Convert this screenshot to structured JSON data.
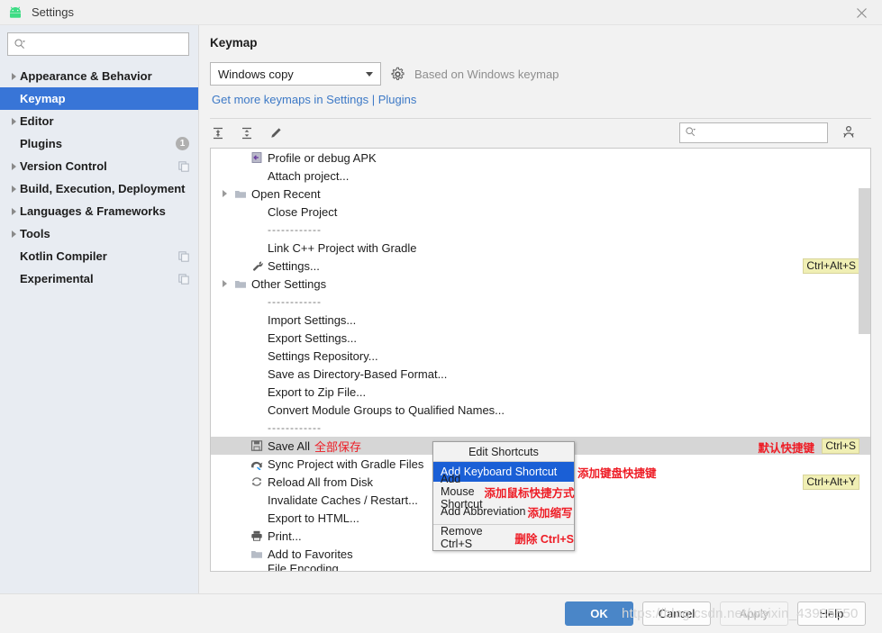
{
  "window": {
    "title": "Settings",
    "app_icon": "android-icon",
    "close_icon": "close-icon"
  },
  "sidebar": {
    "search": {
      "placeholder": "",
      "value": "",
      "icon": "search-icon"
    },
    "items": [
      {
        "label": "Appearance & Behavior",
        "expandable": true,
        "selected": false,
        "badge": null,
        "trailing_icon": null
      },
      {
        "label": "Keymap",
        "expandable": false,
        "selected": true,
        "badge": null,
        "trailing_icon": null
      },
      {
        "label": "Editor",
        "expandable": true,
        "selected": false,
        "badge": null,
        "trailing_icon": null
      },
      {
        "label": "Plugins",
        "expandable": false,
        "selected": false,
        "badge": "1",
        "trailing_icon": null
      },
      {
        "label": "Version Control",
        "expandable": true,
        "selected": false,
        "badge": null,
        "trailing_icon": "copy-icon"
      },
      {
        "label": "Build, Execution, Deployment",
        "expandable": true,
        "selected": false,
        "badge": null,
        "trailing_icon": null
      },
      {
        "label": "Languages & Frameworks",
        "expandable": true,
        "selected": false,
        "badge": null,
        "trailing_icon": null
      },
      {
        "label": "Tools",
        "expandable": true,
        "selected": false,
        "badge": null,
        "trailing_icon": null
      },
      {
        "label": "Kotlin Compiler",
        "expandable": false,
        "selected": false,
        "badge": null,
        "trailing_icon": "copy-icon"
      },
      {
        "label": "Experimental",
        "expandable": false,
        "selected": false,
        "badge": null,
        "trailing_icon": "copy-icon"
      }
    ]
  },
  "main": {
    "title": "Keymap",
    "keymap_select": {
      "value": "Windows copy",
      "caret_icon": "chevron-down-icon"
    },
    "gear_icon": "gear-icon",
    "based_on": "Based on Windows keymap",
    "plugins_link": "Get more keymaps in Settings | Plugins",
    "toolbar": {
      "expand_all_icon": "expand-all-icon",
      "collapse_all_icon": "collapse-all-icon",
      "edit_icon": "pencil-icon"
    },
    "tree_search": {
      "placeholder": "",
      "value": "",
      "icon": "search-icon"
    },
    "filter_icon": "find-actions-icon"
  },
  "tree": {
    "rows": [
      {
        "indent": 2,
        "icon": "profile-apk-icon",
        "label": "Profile or debug APK",
        "arrow": false
      },
      {
        "indent": 2,
        "icon": null,
        "label": "Attach project...",
        "arrow": false
      },
      {
        "indent": 1,
        "icon": "folder-icon",
        "label": "Open Recent",
        "arrow": true
      },
      {
        "indent": 2,
        "icon": null,
        "label": "Close Project",
        "arrow": false
      },
      {
        "indent": 2,
        "icon": null,
        "label": "------------",
        "arrow": false,
        "separator": true
      },
      {
        "indent": 2,
        "icon": null,
        "label": "Link C++ Project with Gradle",
        "arrow": false
      },
      {
        "indent": 2,
        "icon": "wrench-icon",
        "label": "Settings...",
        "arrow": false,
        "shortcut": "Ctrl+Alt+S"
      },
      {
        "indent": 1,
        "icon": "folder-icon",
        "label": "Other Settings",
        "arrow": true
      },
      {
        "indent": 2,
        "icon": null,
        "label": "------------",
        "arrow": false,
        "separator": true
      },
      {
        "indent": 2,
        "icon": null,
        "label": "Import Settings...",
        "arrow": false
      },
      {
        "indent": 2,
        "icon": null,
        "label": "Export Settings...",
        "arrow": false
      },
      {
        "indent": 2,
        "icon": null,
        "label": "Settings Repository...",
        "arrow": false
      },
      {
        "indent": 2,
        "icon": null,
        "label": "Save as Directory-Based Format...",
        "arrow": false
      },
      {
        "indent": 2,
        "icon": null,
        "label": "Export to Zip File...",
        "arrow": false
      },
      {
        "indent": 2,
        "icon": null,
        "label": "Convert Module Groups to Qualified Names...",
        "arrow": false
      },
      {
        "indent": 2,
        "icon": null,
        "label": "------------",
        "arrow": false,
        "separator": true
      },
      {
        "indent": 2,
        "icon": "save-icon",
        "label": "Save All",
        "annotation": "全部保存",
        "arrow": false,
        "selected": true,
        "shortcut": "Ctrl+S",
        "shortcut_note": "默认快捷键"
      },
      {
        "indent": 2,
        "icon": "gradle-icon",
        "label": "Sync Project with Gradle Files",
        "arrow": false
      },
      {
        "indent": 2,
        "icon": "reload-icon",
        "label": "Reload All from Disk",
        "arrow": false,
        "shortcut": "Ctrl+Alt+Y"
      },
      {
        "indent": 2,
        "icon": null,
        "label": "Invalidate Caches / Restart...",
        "arrow": false
      },
      {
        "indent": 2,
        "icon": null,
        "label": "Export to HTML...",
        "arrow": false
      },
      {
        "indent": 2,
        "icon": "printer-icon",
        "label": "Print...",
        "arrow": false
      },
      {
        "indent": 2,
        "icon": "folder-icon",
        "label": "Add to Favorites",
        "arrow": false
      },
      {
        "indent": 2,
        "icon": null,
        "label": "File Encoding",
        "arrow": false,
        "clipped": true
      }
    ]
  },
  "context_menu": {
    "title": "Edit Shortcuts",
    "items": [
      {
        "label": "Add Keyboard Shortcut",
        "annotation": "添加键盘快捷键",
        "active": true,
        "inline": false
      },
      {
        "label": "Add Mouse Shortcut",
        "annotation": "添加鼠标快捷方式",
        "active": false,
        "inline": true
      },
      {
        "label": "Add Abbreviation",
        "annotation": "添加缩写",
        "active": false,
        "inline": true
      },
      {
        "separator": true
      },
      {
        "label": "Remove Ctrl+S",
        "annotation": "删除 Ctrl+S",
        "active": false,
        "inline": true
      }
    ]
  },
  "footer": {
    "ok": "OK",
    "cancel": "Cancel",
    "apply": "Apply",
    "help": "Help"
  },
  "watermark": "https://blog.csdn.net/weixin_43985550",
  "colors": {
    "selection_blue": "#3875d7",
    "menu_highlight": "#1a5fd6",
    "link": "#3d79c6",
    "annotation_red": "#ee1c25",
    "shortcut_bg": "#f0efb4",
    "primary_button": "#4a86c8"
  }
}
